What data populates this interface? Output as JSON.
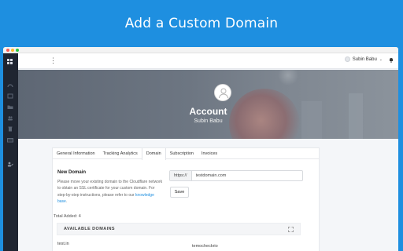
{
  "headline": "Add a Custom Domain",
  "topbar": {
    "kebab": "⋮",
    "user_name": "Subin Babu",
    "user_caret": "⌄"
  },
  "hero": {
    "title": "Account",
    "subtitle": "Subin Babu"
  },
  "tabs": [
    {
      "label": "General Information"
    },
    {
      "label": "Tracking Analytics"
    },
    {
      "label": "Domain",
      "active": true
    },
    {
      "label": "Subscription"
    },
    {
      "label": "Invoices"
    }
  ],
  "new_domain": {
    "title": "New Domain",
    "text": "Please move your existing domain to the Cloudflare network to obtain an SSL certificate for your custom domain. For step-by-step instructions, please refer to our",
    "link": "knowledge base",
    "suffix": "."
  },
  "domain_input": {
    "prefix": "https://",
    "value": "testdomain.com"
  },
  "save_label": "Save",
  "total_label": "Total Added: 4",
  "available": {
    "label": "AVAILABLE DOMAINS"
  },
  "domains": [
    "test.in",
    "temocheckrio"
  ],
  "colors": {
    "brand": "#1e8fe0",
    "sidebar": "#1f2531"
  }
}
